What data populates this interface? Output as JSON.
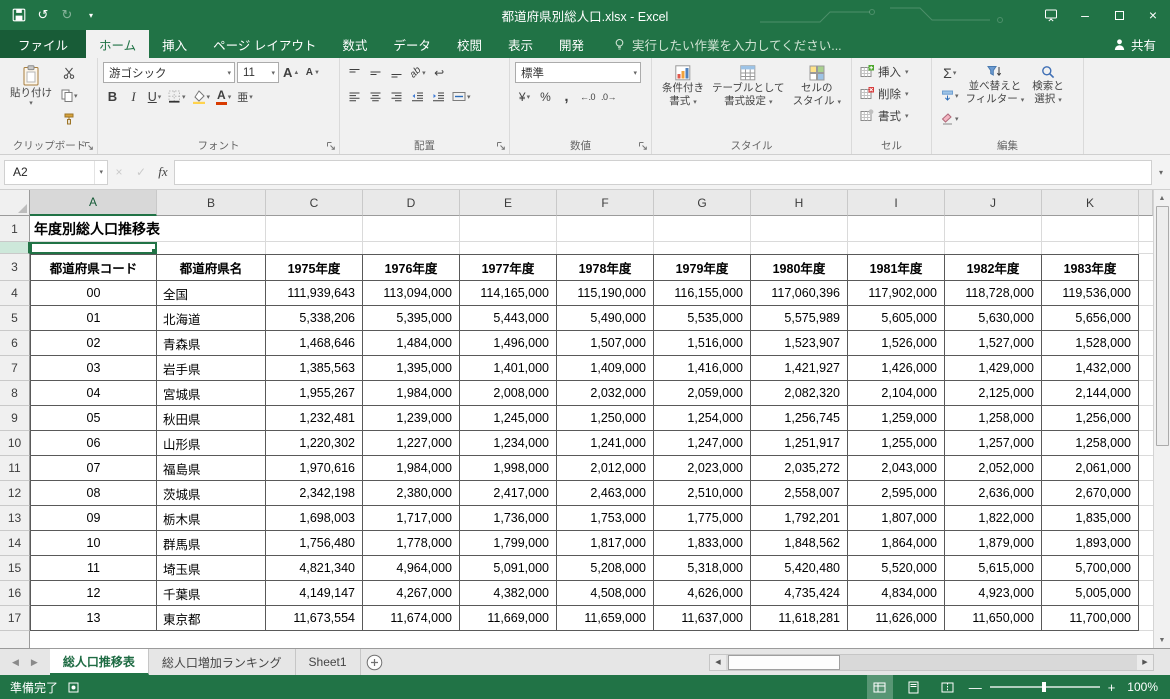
{
  "colors": {
    "accent": "#217346",
    "file_tab_green": "#185c37",
    "ribbon_bg": "#f1f1f1",
    "selection_border": "#217346",
    "table_border": "#595959"
  },
  "window": {
    "title": "都道府県別総人口.xlsx - Excel"
  },
  "icons": {
    "undo": "↺",
    "redo": "↻",
    "caret_down": "▾",
    "minimize": "–",
    "close": "×",
    "up": "▲",
    "down": "▼",
    "left": "◀",
    "right": "▶",
    "cancel": "×",
    "enter": "✓",
    "sigma": "Σ",
    "currency": "¥",
    "percent": "%",
    "comma": ",",
    "increase_decimal": "←.0",
    "decrease_decimal": ".0→",
    "wrap": "↩",
    "orientation": "ab"
  },
  "ribbon_tabs": {
    "file": "ファイル",
    "tabs": [
      "ホーム",
      "挿入",
      "ページ レイアウト",
      "数式",
      "データ",
      "校閲",
      "表示",
      "開発"
    ],
    "active": "ホーム",
    "tell_me": "実行したい作業を入力してください...",
    "share": "共有"
  },
  "ribbon": {
    "clipboard": {
      "label": "クリップボード",
      "paste": "貼り付け"
    },
    "font": {
      "label": "フォント",
      "name": "游ゴシック",
      "size": "11",
      "bold": "B",
      "italic": "I",
      "underline": "U",
      "phonetic": "亜"
    },
    "alignment": {
      "label": "配置"
    },
    "number": {
      "label": "数値",
      "format": "標準"
    },
    "styles": {
      "label": "スタイル",
      "conditional1": "条件付き",
      "conditional2": "書式",
      "table1": "テーブルとして",
      "table2": "書式設定",
      "cell1": "セルの",
      "cell2": "スタイル"
    },
    "cells": {
      "label": "セル",
      "insert": "挿入",
      "delete": "削除",
      "format": "書式"
    },
    "editing": {
      "label": "編集",
      "sort1": "並べ替えと",
      "sort2": "フィルター",
      "find1": "検索と",
      "find2": "選択"
    }
  },
  "formula_bar": {
    "name_box": "A2",
    "fx": "fx",
    "value": ""
  },
  "grid": {
    "columns": [
      "A",
      "B",
      "C",
      "D",
      "E",
      "F",
      "G",
      "H",
      "I",
      "J",
      "K"
    ],
    "row_numbers": [
      "1",
      "3",
      "4",
      "5",
      "6",
      "7",
      "8",
      "9",
      "10",
      "11",
      "12",
      "13",
      "14",
      "15",
      "16",
      "17"
    ],
    "title_cell": "年度別総人口推移表",
    "headers": [
      "都道府県コード",
      "都道府県名",
      "1975年度",
      "1976年度",
      "1977年度",
      "1978年度",
      "1979年度",
      "1980年度",
      "1981年度",
      "1982年度",
      "1983年度"
    ],
    "rows": [
      [
        "00",
        "全国",
        "111,939,643",
        "113,094,000",
        "114,165,000",
        "115,190,000",
        "116,155,000",
        "117,060,396",
        "117,902,000",
        "118,728,000",
        "119,536,000"
      ],
      [
        "01",
        "北海道",
        "5,338,206",
        "5,395,000",
        "5,443,000",
        "5,490,000",
        "5,535,000",
        "5,575,989",
        "5,605,000",
        "5,630,000",
        "5,656,000"
      ],
      [
        "02",
        "青森県",
        "1,468,646",
        "1,484,000",
        "1,496,000",
        "1,507,000",
        "1,516,000",
        "1,523,907",
        "1,526,000",
        "1,527,000",
        "1,528,000"
      ],
      [
        "03",
        "岩手県",
        "1,385,563",
        "1,395,000",
        "1,401,000",
        "1,409,000",
        "1,416,000",
        "1,421,927",
        "1,426,000",
        "1,429,000",
        "1,432,000"
      ],
      [
        "04",
        "宮城県",
        "1,955,267",
        "1,984,000",
        "2,008,000",
        "2,032,000",
        "2,059,000",
        "2,082,320",
        "2,104,000",
        "2,125,000",
        "2,144,000"
      ],
      [
        "05",
        "秋田県",
        "1,232,481",
        "1,239,000",
        "1,245,000",
        "1,250,000",
        "1,254,000",
        "1,256,745",
        "1,259,000",
        "1,258,000",
        "1,256,000"
      ],
      [
        "06",
        "山形県",
        "1,220,302",
        "1,227,000",
        "1,234,000",
        "1,241,000",
        "1,247,000",
        "1,251,917",
        "1,255,000",
        "1,257,000",
        "1,258,000"
      ],
      [
        "07",
        "福島県",
        "1,970,616",
        "1,984,000",
        "1,998,000",
        "2,012,000",
        "2,023,000",
        "2,035,272",
        "2,043,000",
        "2,052,000",
        "2,061,000"
      ],
      [
        "08",
        "茨城県",
        "2,342,198",
        "2,380,000",
        "2,417,000",
        "2,463,000",
        "2,510,000",
        "2,558,007",
        "2,595,000",
        "2,636,000",
        "2,670,000"
      ],
      [
        "09",
        "栃木県",
        "1,698,003",
        "1,717,000",
        "1,736,000",
        "1,753,000",
        "1,775,000",
        "1,792,201",
        "1,807,000",
        "1,822,000",
        "1,835,000"
      ],
      [
        "10",
        "群馬県",
        "1,756,480",
        "1,778,000",
        "1,799,000",
        "1,817,000",
        "1,833,000",
        "1,848,562",
        "1,864,000",
        "1,879,000",
        "1,893,000"
      ],
      [
        "11",
        "埼玉県",
        "4,821,340",
        "4,964,000",
        "5,091,000",
        "5,208,000",
        "5,318,000",
        "5,420,480",
        "5,520,000",
        "5,615,000",
        "5,700,000"
      ],
      [
        "12",
        "千葉県",
        "4,149,147",
        "4,267,000",
        "4,382,000",
        "4,508,000",
        "4,626,000",
        "4,735,424",
        "4,834,000",
        "4,923,000",
        "5,005,000"
      ],
      [
        "13",
        "東京都",
        "11,673,554",
        "11,674,000",
        "11,669,000",
        "11,659,000",
        "11,637,000",
        "11,618,281",
        "11,626,000",
        "11,650,000",
        "11,700,000"
      ]
    ]
  },
  "sheet_bar": {
    "tabs": [
      "総人口推移表",
      "総人口増加ランキング",
      "Sheet1"
    ],
    "active": "総人口推移表"
  },
  "status_bar": {
    "ready": "準備完了",
    "zoom_out": "—",
    "zoom_in": "+",
    "zoom_level": "100%"
  }
}
